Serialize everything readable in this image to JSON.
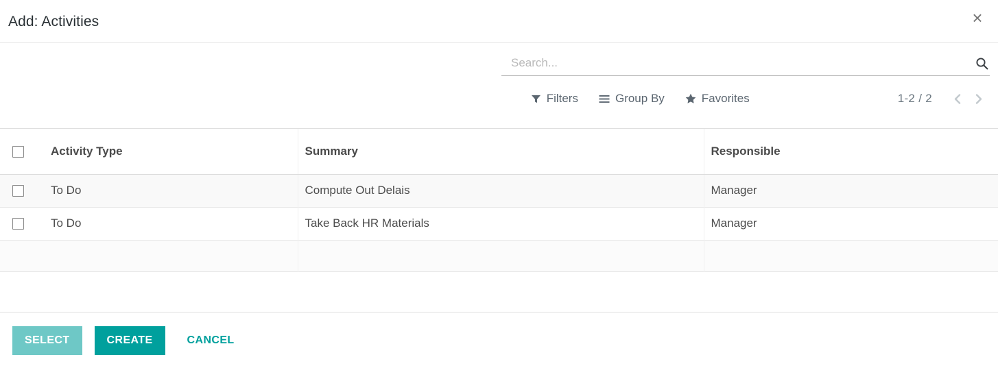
{
  "dialog": {
    "title": "Add: Activities",
    "close_icon": "close-icon"
  },
  "search": {
    "placeholder": "Search...",
    "value": "",
    "icon": "search-icon"
  },
  "controls": {
    "filters_label": "Filters",
    "filters_icon": "funnel-icon",
    "group_by_label": "Group By",
    "group_by_icon": "bars-icon",
    "favorites_label": "Favorites",
    "favorites_icon": "star-icon"
  },
  "pager": {
    "value": "1-2 / 2",
    "previous_icon": "chevron-left-icon",
    "next_icon": "chevron-right-icon"
  },
  "table": {
    "columns": [
      "Activity Type",
      "Summary",
      "Responsible"
    ],
    "rows": [
      {
        "activity_type": "To Do",
        "summary": "Compute Out Delais",
        "responsible": "Manager"
      },
      {
        "activity_type": "To Do",
        "summary": "Take Back HR Materials",
        "responsible": "Manager"
      }
    ]
  },
  "footer": {
    "select_label": "SELECT",
    "create_label": "CREATE",
    "cancel_label": "CANCEL"
  },
  "colors": {
    "accent": "#00a09d",
    "accent_muted": "#6ec8c6",
    "text": "#4c4c4c",
    "control_text": "#5b6670"
  }
}
